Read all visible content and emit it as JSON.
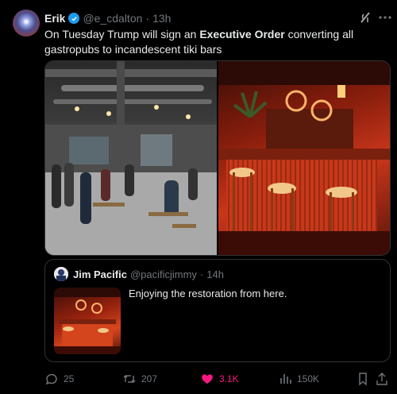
{
  "post": {
    "author_name": "Erik",
    "handle": "@e_cdalton",
    "separator": "·",
    "time": "13h",
    "text_before": "On Tuesday Trump will sign an ",
    "text_bold": "Executive Order",
    "text_after": " converting all gastropubs to incandescent tiki bars"
  },
  "quote": {
    "author_name": "Jim Pacific",
    "handle": "@pacificjimmy",
    "separator": "·",
    "time": "14h",
    "text": "Enjoying the restoration from here."
  },
  "actions": {
    "replies": "25",
    "reposts": "207",
    "likes": "3.1K",
    "views": "150K"
  },
  "colors": {
    "background": "#000000",
    "accent": "#1d9bf0",
    "like": "#f91880",
    "muted": "#71767b"
  }
}
